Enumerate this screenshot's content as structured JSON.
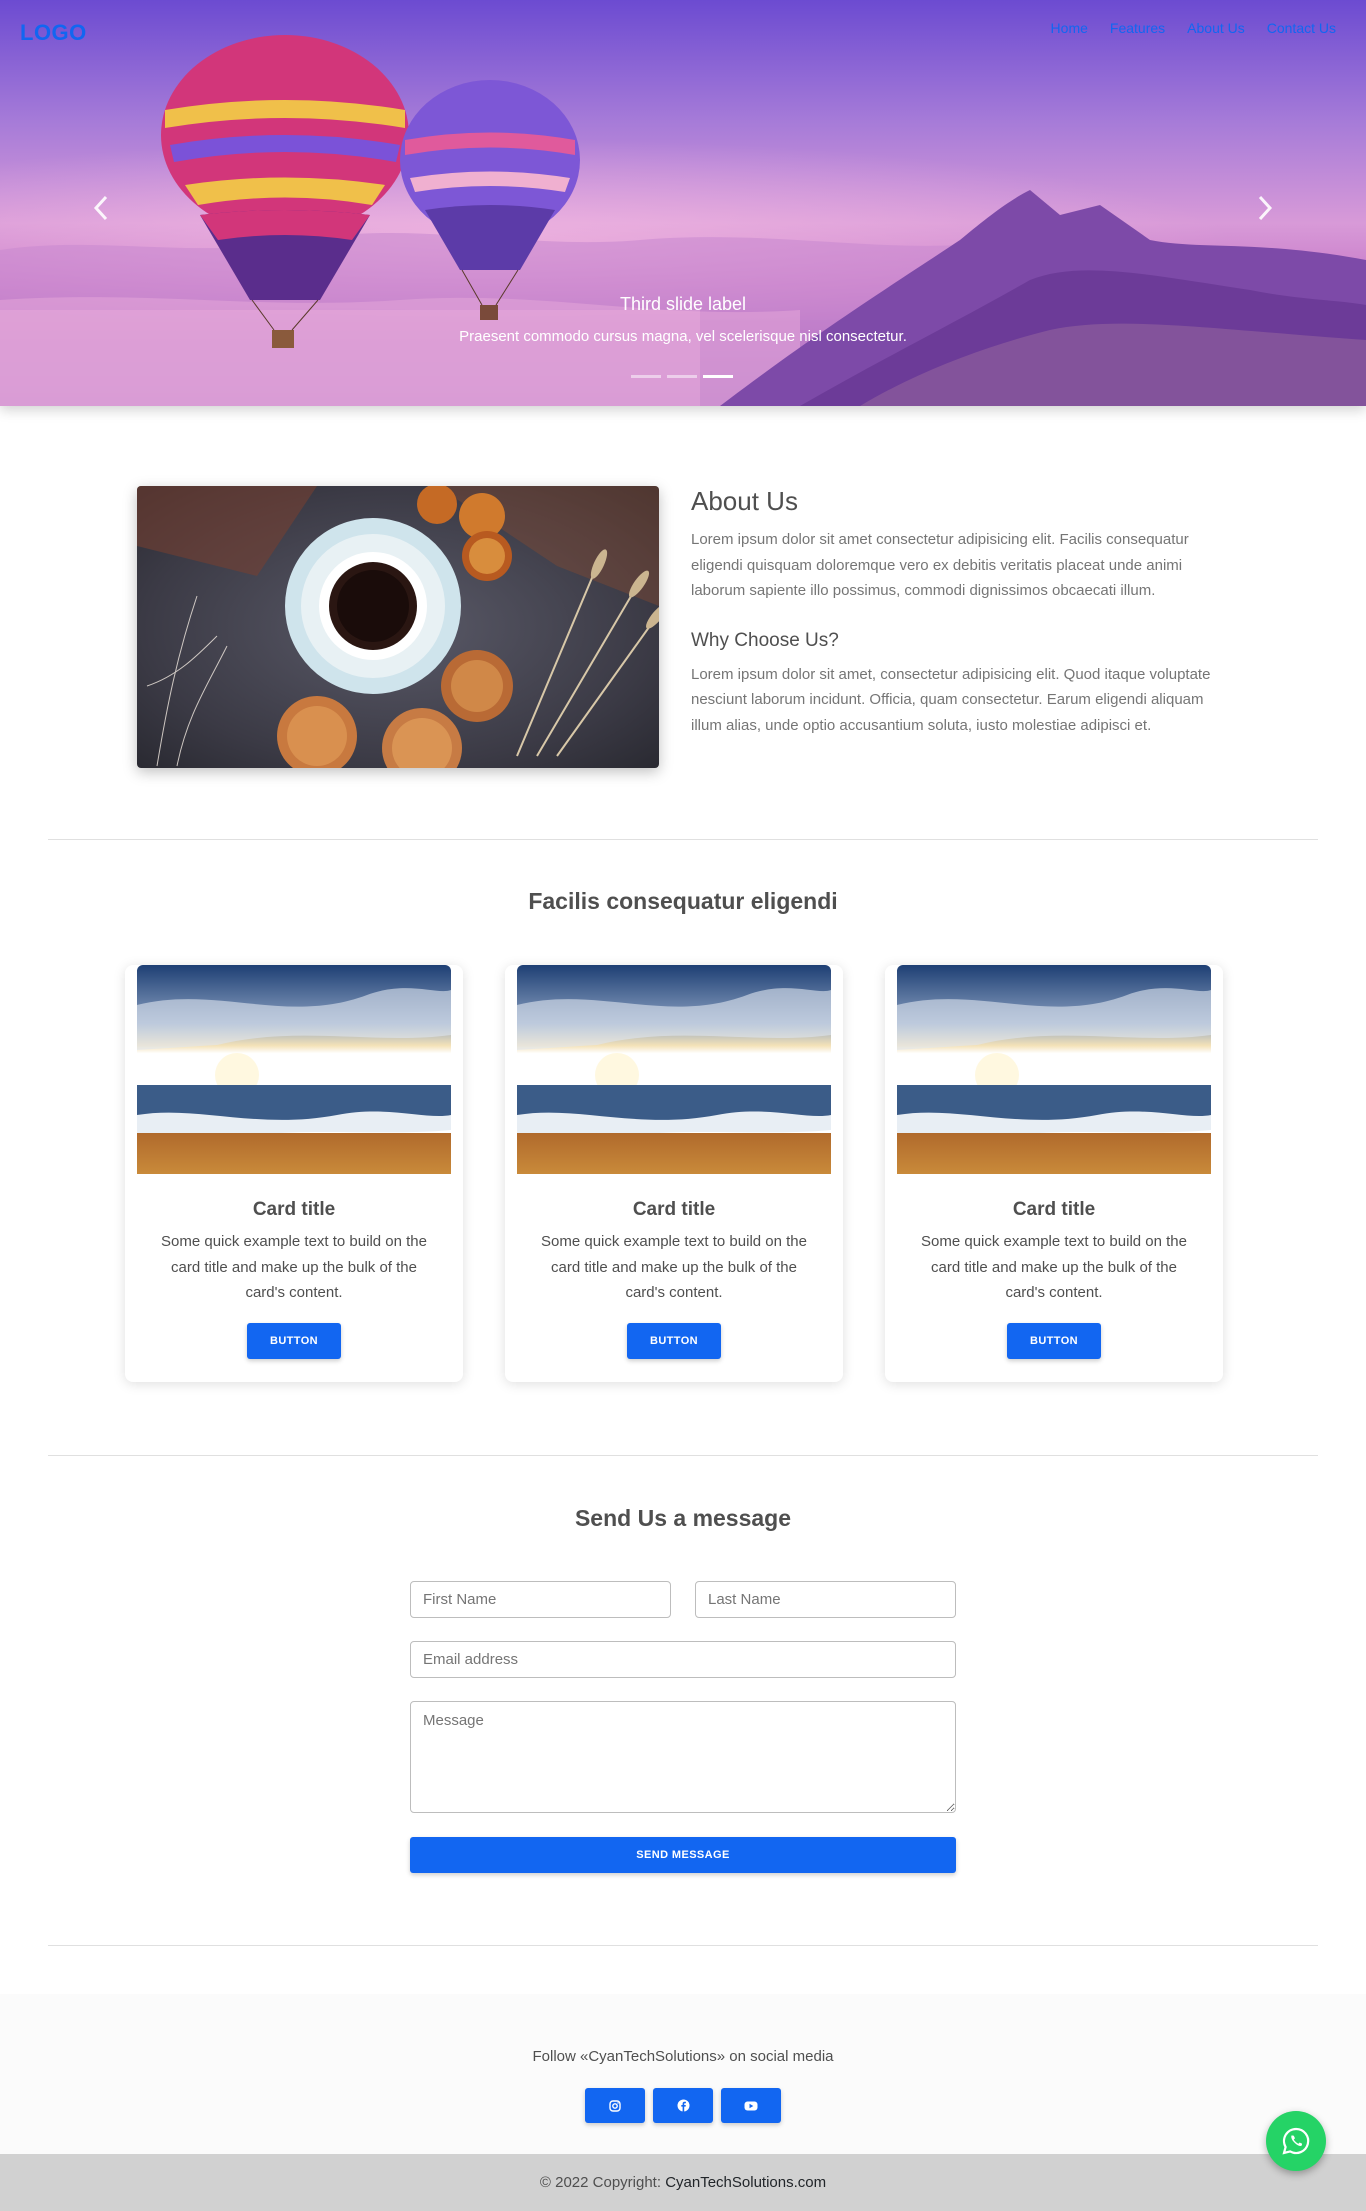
{
  "header": {
    "logo": "LOGO",
    "nav": [
      "Home",
      "Features",
      "About Us",
      "Contact Us"
    ]
  },
  "carousel": {
    "title": "Third slide label",
    "text": "Praesent commodo cursus magna, vel scelerisque nisl consectetur.",
    "prev_icon": "chevron-left-icon",
    "next_icon": "chevron-right-icon",
    "slide_count": 3,
    "active_slide": 3
  },
  "about": {
    "title": "About Us",
    "text": "Lorem ipsum dolor sit amet consectetur adipisicing elit. Facilis consequatur eligendi quisquam doloremque vero ex debitis veritatis placeat unde animi laborum sapiente illo possimus, commodi dignissimos obcaecati illum.",
    "subtitle": "Why Choose Us?",
    "subtext": "Lorem ipsum dolor sit amet, consectetur adipisicing elit. Quod itaque voluptate nesciunt laborum incidunt. Officia, quam consectetur. Earum eligendi aliquam illum alias, unde optio accusantium soluta, iusto molestiae adipisci et."
  },
  "cards_section": {
    "title": "Facilis consequatur eligendi",
    "cards": [
      {
        "title": "Card title",
        "text": "Some quick example text to build on the card title and make up the bulk of the card's content.",
        "button": "Button"
      },
      {
        "title": "Card title",
        "text": "Some quick example text to build on the card title and make up the bulk of the card's content.",
        "button": "Button"
      },
      {
        "title": "Card title",
        "text": "Some quick example text to build on the card title and make up the bulk of the card's content.",
        "button": "Button"
      }
    ]
  },
  "contact": {
    "title": "Send Us a message",
    "first_name_placeholder": "First Name",
    "last_name_placeholder": "Last Name",
    "email_placeholder": "Email address",
    "message_placeholder": "Message",
    "submit": "Send message"
  },
  "footer": {
    "follow_text": "Follow «CyanTechSolutions» on social media",
    "social_icons": [
      "instagram-icon",
      "facebook-icon",
      "youtube-icon"
    ],
    "copyright_prefix": "© 2022 Copyright: ",
    "copyright_link": "CyanTechSolutions.com"
  },
  "colors": {
    "primary": "#1266f1",
    "whatsapp": "#25d366"
  }
}
